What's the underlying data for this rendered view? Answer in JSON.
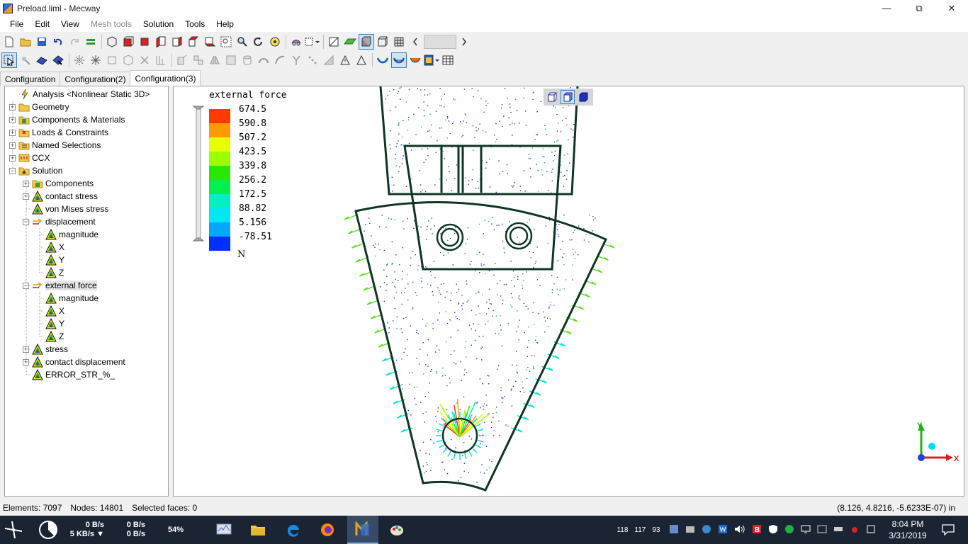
{
  "window": {
    "title": "Preload.liml - Mecway"
  },
  "menu": [
    "File",
    "Edit",
    "View",
    "Mesh tools",
    "Solution",
    "Tools",
    "Help"
  ],
  "tabs": [
    "Configuration",
    "Configuration(2)",
    "Configuration(3)"
  ],
  "tree": {
    "analysis": "Analysis <Nonlinear Static 3D>",
    "geometry": "Geometry",
    "components_materials": "Components & Materials",
    "loads_constraints": "Loads & Constraints",
    "named_selections": "Named Selections",
    "ccx": "CCX",
    "solution": "Solution",
    "components": "Components",
    "contact_stress": "contact stress",
    "von_mises": "von Mises stress",
    "displacement": "displacement",
    "disp_magnitude": "magnitude",
    "disp_x": "X",
    "disp_y": "Y",
    "disp_z": "Z",
    "external_force": "external force",
    "ext_magnitude": "magnitude",
    "ext_x": "X",
    "ext_y": "Y",
    "ext_z": "Z",
    "stress": "stress",
    "contact_displacement": "contact displacement",
    "error_str": "ERROR_STR_%_"
  },
  "legend": {
    "title": "external force",
    "unit": "N",
    "values": [
      "674.5",
      "590.8",
      "507.2",
      "423.5",
      "339.8",
      "256.2",
      "172.5",
      "88.82",
      "5.156",
      "-78.51"
    ],
    "colors": [
      "#ff3a00",
      "#ff9a00",
      "#e8ff00",
      "#9cff00",
      "#28e800",
      "#00f050",
      "#00f0c0",
      "#00e8f0",
      "#00a8ff",
      "#0030ff"
    ]
  },
  "axis_triad": {
    "y_label": "Y",
    "x_label": "X"
  },
  "status": {
    "elements": "Elements: 7097",
    "nodes": "Nodes: 14801",
    "selected": "Selected faces: 0",
    "coords": "(8.126, 4.8216, -5.6233E-07) in"
  },
  "taskbar": {
    "net1_up": "0 B/s",
    "net1_down": "5 KB/s",
    "net2_up": "0 B/s",
    "net2_down": "0 B/s",
    "cpu": "54%",
    "tray_nums": [
      "118",
      "117",
      "93"
    ],
    "time": "8:04 PM",
    "date": "3/31/2019"
  }
}
